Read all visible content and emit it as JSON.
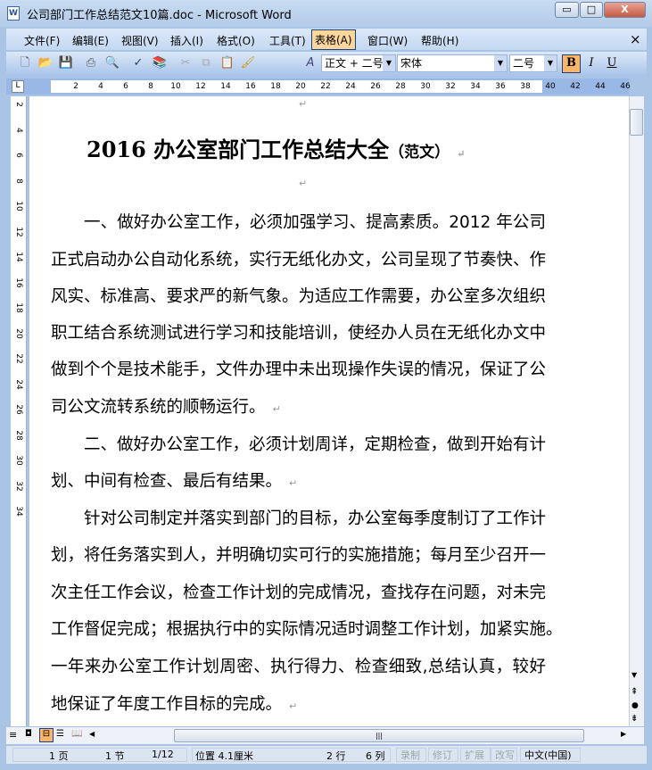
{
  "window": {
    "title": "公司部门工作总结范文10篇.doc - Microsoft Word",
    "min": "▭",
    "max": "□",
    "close": "X"
  },
  "menu": [
    "文件(F)",
    "编辑(E)",
    "视图(V)",
    "插入(I)",
    "格式(O)",
    "工具(T)",
    "表格(A)",
    "窗口(W)",
    "帮助(H)"
  ],
  "menu_close": "×",
  "format": {
    "style": "正文 + 二号",
    "font": "宋体",
    "size": "二号",
    "bold": "B",
    "italic": "I",
    "underline": "U"
  },
  "ruler": {
    "h": [
      "2",
      "4",
      "6",
      "8",
      "10",
      "12",
      "14",
      "16",
      "18",
      "20",
      "22",
      "24",
      "26",
      "28",
      "30",
      "32",
      "34",
      "36",
      "38",
      "40",
      "42",
      "44",
      "46"
    ],
    "v": [
      "2",
      "4",
      "6",
      "8",
      "10",
      "12",
      "14",
      "16",
      "18",
      "20",
      "22",
      "24",
      "26",
      "28",
      "30",
      "32",
      "34"
    ]
  },
  "doc": {
    "title_main": "2016 办公室部门工作总结大全",
    "title_sub": "（范文）",
    "mark": "↵",
    "paragraphs": [
      {
        "lines": [
          "一、做好办公室工作，必须加强学习、提高素质。2012 年公司",
          "正式启动办公自动化系统，实行无纸化办文，公司呈现了节奏快、作",
          "风实、标准高、要求严的新气象。为适应工作需要，办公室多次组织",
          "职工结合系统测试进行学习和技能培训，使经办人员在无纸化办文中",
          "做到个个是技术能手，文件办理中未出现操作失误的情况，保证了公",
          "司公文流转系统的顺畅运行。"
        ]
      },
      {
        "lines": [
          "二、做好办公室工作，必须计划周详，定期检查，做到开始有计",
          "划、中间有检查、最后有结果。"
        ]
      },
      {
        "lines": [
          "针对公司制定并落实到部门的目标，办公室每季度制订了工作计",
          "划，将任务落实到人，并明确切实可行的实施措施；每月至少召开一",
          "次主任工作会议，检查工作计划的完成情况，查找存在问题，对未完",
          "工作督促完成；根据执行中的实际情况适时调整工作计划，加紧实施。",
          "一年来办公室工作计划周密、执行得力、检查细致,总结认真，较好",
          "地保证了年度工作目标的完成。"
        ]
      }
    ]
  },
  "status": {
    "page": "1 页",
    "section": "1 节",
    "pages": "1/12",
    "position": "位置 4.1厘米",
    "line": "2 行",
    "col": "6 列",
    "rec": "录制",
    "trk": "修订",
    "ext": "扩展",
    "ovr": "改写",
    "lang": "中文(中国)"
  }
}
